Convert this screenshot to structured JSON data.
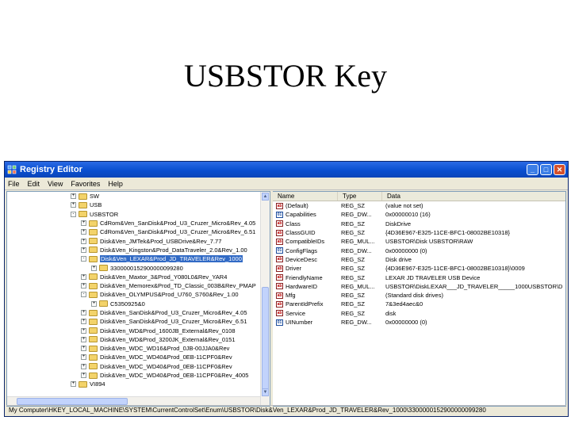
{
  "slide": {
    "title": "USBSTOR Key"
  },
  "window": {
    "title": "Registry Editor",
    "menu": [
      "File",
      "Edit",
      "View",
      "Favorites",
      "Help"
    ]
  },
  "tree": {
    "items": [
      {
        "label": "SW",
        "indent": 0,
        "expander": "+",
        "selected": false
      },
      {
        "label": "USB",
        "indent": 0,
        "expander": "+",
        "selected": false
      },
      {
        "label": "USBSTOR",
        "indent": 0,
        "expander": "-",
        "selected": false
      },
      {
        "label": "CdRom&Ven_SanDisk&Prod_U3_Cruzer_Micro&Rev_4.05",
        "indent": 1,
        "expander": "+",
        "selected": false
      },
      {
        "label": "CdRom&Ven_SanDisk&Prod_U3_Cruzer_Micro&Rev_6.51",
        "indent": 1,
        "expander": "+",
        "selected": false
      },
      {
        "label": "Disk&Ven_JMTek&Prod_USBDrive&Rev_7.77",
        "indent": 1,
        "expander": "+",
        "selected": false
      },
      {
        "label": "Disk&Ven_Kingston&Prod_DataTraveler_2.0&Rev_1.00",
        "indent": 1,
        "expander": "+",
        "selected": false
      },
      {
        "label": "Disk&Ven_LEXAR&Prod_JD_TRAVELER&Rev_1000",
        "indent": 1,
        "expander": "-",
        "selected": true
      },
      {
        "label": "3300000152900000099280",
        "indent": 2,
        "expander": "+",
        "selected": false
      },
      {
        "label": "Disk&Ven_Maxtor_3&Prod_Y080L0&Rev_YAR4",
        "indent": 1,
        "expander": "+",
        "selected": false
      },
      {
        "label": "Disk&Ven_Memorex&Prod_TD_Classic_003B&Rev_PMAP",
        "indent": 1,
        "expander": "+",
        "selected": false
      },
      {
        "label": "Disk&Ven_OLYMPUS&Prod_U760_S760&Rev_1.00",
        "indent": 1,
        "expander": "-",
        "selected": false
      },
      {
        "label": "C5350925&0",
        "indent": 2,
        "expander": "+",
        "selected": false
      },
      {
        "label": "Disk&Ven_SanDisk&Prod_U3_Cruzer_Micro&Rev_4.05",
        "indent": 1,
        "expander": "+",
        "selected": false
      },
      {
        "label": "Disk&Ven_SanDisk&Prod_U3_Cruzer_Micro&Rev_6.51",
        "indent": 1,
        "expander": "+",
        "selected": false
      },
      {
        "label": "Disk&Ven_WD&Prod_1600JB_External&Rev_0108",
        "indent": 1,
        "expander": "+",
        "selected": false
      },
      {
        "label": "Disk&Ven_WD&Prod_3200JK_External&Rev_0151",
        "indent": 1,
        "expander": "+",
        "selected": false
      },
      {
        "label": "Disk&Ven_WDC_WD16&Prod_0JB-00JJA0&Rev",
        "indent": 1,
        "expander": "+",
        "selected": false
      },
      {
        "label": "Disk&Ven_WDC_WD40&Prod_0EB-11CPF0&Rev",
        "indent": 1,
        "expander": "+",
        "selected": false
      },
      {
        "label": "Disk&Ven_WDC_WD40&Prod_0EB-11CPF0&Rev",
        "indent": 1,
        "expander": "+",
        "selected": false
      },
      {
        "label": "Disk&Ven_WDC_WD40&Prod_0EB-11CPF0&Rev_4005",
        "indent": 1,
        "expander": "+",
        "selected": false
      },
      {
        "label": "VI894",
        "indent": 0,
        "expander": "+",
        "selected": false
      }
    ]
  },
  "values_table": {
    "columns": [
      "Name",
      "Type",
      "Data"
    ],
    "rows": [
      {
        "name": "(Default)",
        "type": "REG_SZ",
        "data": "(value not set)",
        "icon": "ab"
      },
      {
        "name": "Capabilities",
        "type": "REG_DW...",
        "data": "0x00000010 (16)",
        "icon": "bin"
      },
      {
        "name": "Class",
        "type": "REG_SZ",
        "data": "DiskDrive",
        "icon": "ab"
      },
      {
        "name": "ClassGUID",
        "type": "REG_SZ",
        "data": "{4D36E967-E325-11CE-BFC1-08002BE10318}",
        "icon": "ab"
      },
      {
        "name": "CompatibleIDs",
        "type": "REG_MUL...",
        "data": "USBSTOR\\Disk USBSTOR\\RAW",
        "icon": "ab"
      },
      {
        "name": "ConfigFlags",
        "type": "REG_DW...",
        "data": "0x00000000 (0)",
        "icon": "bin"
      },
      {
        "name": "DeviceDesc",
        "type": "REG_SZ",
        "data": "Disk drive",
        "icon": "ab"
      },
      {
        "name": "Driver",
        "type": "REG_SZ",
        "data": "{4D36E967-E325-11CE-BFC1-08002BE10318}\\0009",
        "icon": "ab"
      },
      {
        "name": "FriendlyName",
        "type": "REG_SZ",
        "data": "LEXAR JD TRAVELER USB Device",
        "icon": "ab"
      },
      {
        "name": "HardwareID",
        "type": "REG_MUL...",
        "data": "USBSTOR\\DiskLEXAR___JD_TRAVELER_____1000USBSTOR\\D",
        "icon": "ab"
      },
      {
        "name": "Mfg",
        "type": "REG_SZ",
        "data": "(Standard disk drives)",
        "icon": "ab"
      },
      {
        "name": "ParentIdPrefix",
        "type": "REG_SZ",
        "data": "7&3ed4aec&0",
        "icon": "ab"
      },
      {
        "name": "Service",
        "type": "REG_SZ",
        "data": "disk",
        "icon": "ab"
      },
      {
        "name": "UINumber",
        "type": "REG_DW...",
        "data": "0x00000000 (0)",
        "icon": "bin"
      }
    ]
  },
  "status_bar": {
    "path": "My Computer\\HKEY_LOCAL_MACHINE\\SYSTEM\\CurrentControlSet\\Enum\\USBSTOR\\Disk&Ven_LEXAR&Prod_JD_TRAVELER&Rev_1000\\3300000152900000099280"
  }
}
